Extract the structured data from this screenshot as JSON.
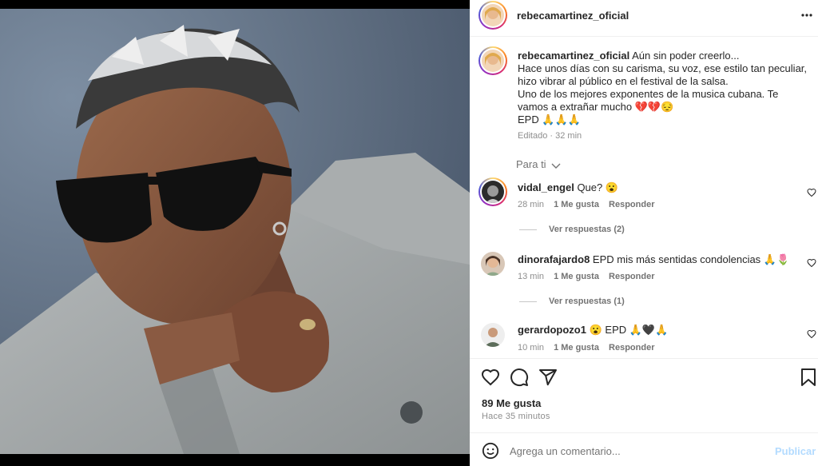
{
  "post": {
    "author": "rebecamartinez_oficial",
    "more_icon": "ellipsis-icon",
    "caption_lines": [
      "Aún sin poder creerlo...",
      "Hace unos días con su carisma, su voz, ese estilo tan peculiar,",
      "hizo vibrar al público en el festival de la salsa.",
      "Uno de los mejores exponentes de la musica cubana. Te",
      "vamos a extrañar mucho 💔💔😔",
      "EPD 🙏🙏🙏"
    ],
    "edited_label": "Editado",
    "edited_separator": "·",
    "edited_time": "32 min",
    "for_you_label": "Para ti"
  },
  "comments": [
    {
      "user": "vidal_engel",
      "text": "Que? 😮",
      "time": "28 min",
      "likes": "1 Me gusta",
      "reply": "Responder",
      "view_replies": "Ver respuestas (2)"
    },
    {
      "user": "dinorafajardo8",
      "text": "EPD mis más sentidas condolencias 🙏🌷",
      "time": "13 min",
      "likes": "1 Me gusta",
      "reply": "Responder",
      "view_replies": "Ver respuestas (1)"
    },
    {
      "user": "gerardopozo1",
      "text": "😮 EPD 🙏🖤🙏",
      "time": "10 min",
      "likes": "1 Me gusta",
      "reply": "Responder"
    }
  ],
  "actions": {
    "like_icon": "heart-icon",
    "comment_icon": "comment-icon",
    "share_icon": "send-icon",
    "save_icon": "bookmark-icon"
  },
  "stats": {
    "likes": "89 Me gusta",
    "posted": "Hace 35 minutos"
  },
  "composer": {
    "emoji_icon": "smiley-icon",
    "placeholder": "Agrega un comentario...",
    "publish": "Publicar"
  },
  "colors": {
    "publish_disabled": "#b3dbff",
    "meta_gray": "#8e8e8e"
  }
}
